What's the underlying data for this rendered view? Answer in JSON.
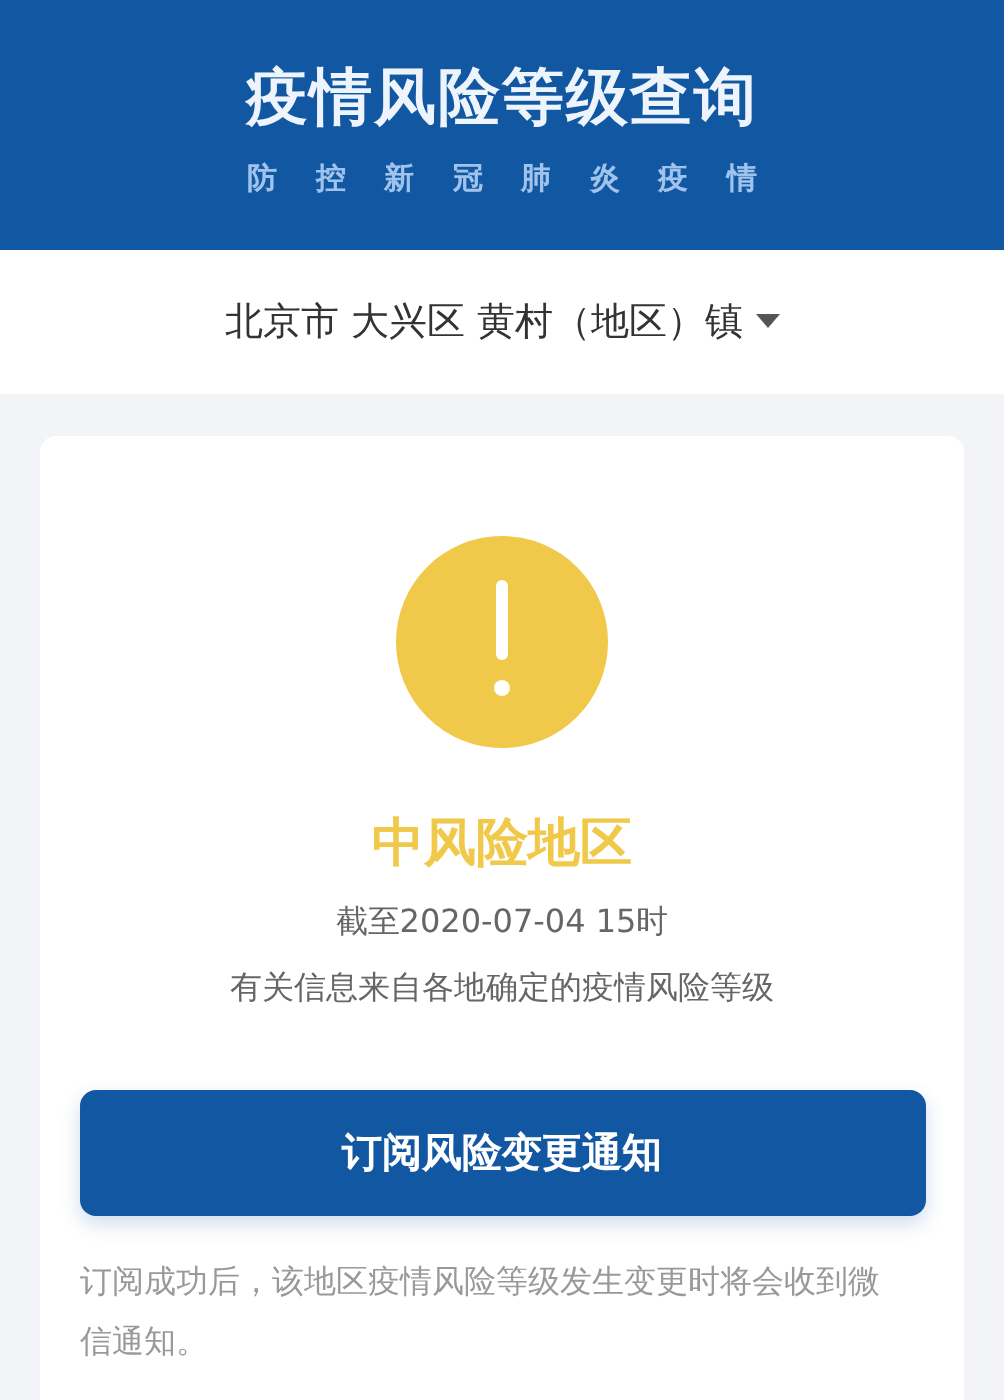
{
  "header": {
    "title": "疫情风险等级查询",
    "subtitle": "防 控 新 冠 肺 炎 疫 情"
  },
  "location": {
    "value": "北京市 大兴区 黄村（地区）镇"
  },
  "result": {
    "kind": "medium",
    "label": "中风险地区",
    "date": "截至2020-07-04 15时",
    "source": "有关信息来自各地确定的疫情风险等级"
  },
  "subscribe_button": "订阅风险变更通知",
  "note": "订阅成功后，该地区疫情风险等级发生变更时将会收到微信通知。"
}
